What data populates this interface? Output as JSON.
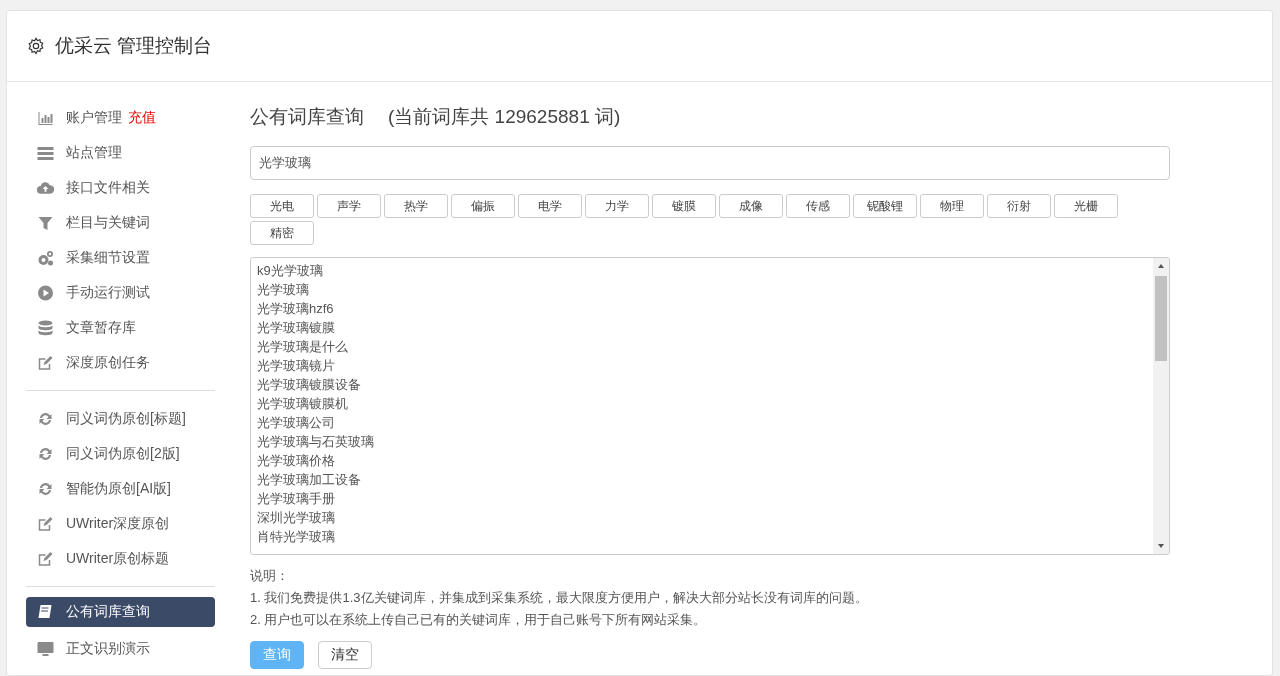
{
  "header": {
    "title": "优采云 管理控制台"
  },
  "sidebar": {
    "groups": [
      {
        "items": [
          {
            "label": "账户管理",
            "badge": "充值",
            "selected": false
          },
          {
            "label": "站点管理",
            "selected": false
          },
          {
            "label": "接口文件相关",
            "selected": false
          },
          {
            "label": "栏目与关键词",
            "selected": false
          },
          {
            "label": "采集细节设置",
            "selected": false
          },
          {
            "label": "手动运行测试",
            "selected": false
          },
          {
            "label": "文章暂存库",
            "selected": false
          },
          {
            "label": "深度原创任务",
            "selected": false
          }
        ]
      },
      {
        "items": [
          {
            "label": "同义词伪原创[标题]",
            "selected": false
          },
          {
            "label": "同义词伪原创[2版]",
            "selected": false
          },
          {
            "label": "智能伪原创[AI版]",
            "selected": false
          },
          {
            "label": "UWriter深度原创",
            "selected": false
          },
          {
            "label": "UWriter原创标题",
            "selected": false
          }
        ]
      },
      {
        "items": [
          {
            "label": "公有词库查询",
            "selected": true
          },
          {
            "label": "正文识别演示",
            "selected": false
          }
        ]
      }
    ]
  },
  "main": {
    "title": "公有词库查询",
    "count_text": "(当前词库共 129625881 词)",
    "search": {
      "value": "光学玻璃"
    },
    "tags": [
      "光电",
      "声学",
      "热学",
      "偏振",
      "电学",
      "力学",
      "镀膜",
      "成像",
      "传感",
      "铌酸锂",
      "物理",
      "衍射",
      "光栅",
      "精密"
    ],
    "results": [
      "k9光学玻璃",
      "光学玻璃",
      "光学玻璃hzf6",
      "光学玻璃镀膜",
      "光学玻璃是什么",
      "光学玻璃镜片",
      "光学玻璃镀膜设备",
      "光学玻璃镀膜机",
      "光学玻璃公司",
      "光学玻璃与石英玻璃",
      "光学玻璃价格",
      "光学玻璃加工设备",
      "光学玻璃手册",
      "深圳光学玻璃",
      "肖特光学玻璃"
    ],
    "notes_title": "说明：",
    "notes": [
      "1. 我们免费提供1.3亿关键词库，并集成到采集系统，最大限度方便用户，解决大部分站长没有词库的问题。",
      "2. 用户也可以在系统上传自己已有的关键词库，用于自己账号下所有网站采集。"
    ],
    "buttons": [
      {
        "label": "查询",
        "kind": "primary"
      },
      {
        "label": "清空",
        "kind": "default"
      }
    ]
  }
}
